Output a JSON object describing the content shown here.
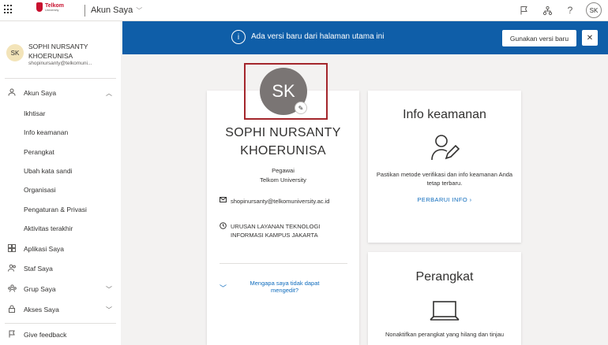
{
  "topbar": {
    "logo_line1": "Telkom",
    "logo_line2": "University",
    "app_title": "Akun Saya",
    "avatar_initials": "SK"
  },
  "sidebar": {
    "user": {
      "initials": "SK",
      "name": "SOPHI NURSANTY KHOERUNISA",
      "email": "shopinursanty@telkomuni..."
    },
    "akun_saya": "Akun Saya",
    "subitems": [
      "Ikhtisar",
      "Info keamanan",
      "Perangkat",
      "Ubah kata sandi",
      "Organisasi",
      "Pengaturan & Privasi",
      "Aktivitas terakhir"
    ],
    "aplikasi_saya": "Aplikasi Saya",
    "staf_saya": "Staf Saya",
    "grup_saya": "Grup Saya",
    "akses_saya": "Akses Saya",
    "give_feedback": "Give feedback"
  },
  "banner": {
    "text": "Ada versi baru dari halaman utama ini",
    "button": "Gunakan versi baru",
    "close": "✕",
    "bg_color": "#0f5ea8"
  },
  "profile": {
    "initials": "SK",
    "name": "SOPHI NURSANTY KHOERUNISA",
    "role": "Pegawai",
    "org": "Telkom University",
    "email": "shopinursanty@telkomuniversity.ac.id",
    "department": "URUSAN LAYANAN TEKNOLOGI INFORMASI KAMPUS JAKARTA",
    "edit_link": "Mengapa saya tidak dapat mengedit?"
  },
  "security": {
    "title": "Info keamanan",
    "description": "Pastikan metode verifikasi dan info keamanan Anda tetap terbaru.",
    "link": "PERBARUI INFO"
  },
  "devices": {
    "title": "Perangkat",
    "description": "Nonaktifkan perangkat yang hilang dan tinjau"
  },
  "colors": {
    "accent": "#0f6cbd",
    "highlight_border": "#a4262c",
    "avatar_bg": "#7a7574"
  }
}
